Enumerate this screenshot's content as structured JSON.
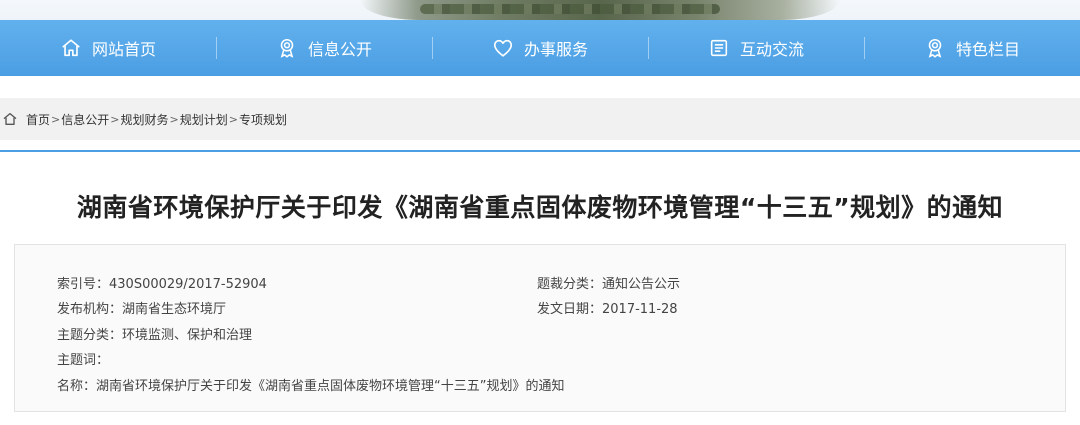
{
  "nav": {
    "items": [
      {
        "label": "网站首页",
        "icon": "home-icon"
      },
      {
        "label": "信息公开",
        "icon": "badge-icon"
      },
      {
        "label": "办事服务",
        "icon": "heart-icon"
      },
      {
        "label": "互动交流",
        "icon": "list-icon"
      },
      {
        "label": "特色栏目",
        "icon": "badge-icon"
      }
    ]
  },
  "breadcrumb": {
    "items": [
      "首页",
      "信息公开",
      "规划财务",
      "规划计划",
      "专项规划"
    ],
    "separator": ">"
  },
  "page_title": "湖南省环境保护厅关于印发《湖南省重点固体废物环境管理“十三五”规划》的通知",
  "meta": {
    "index_no": {
      "label": "索引号：",
      "value": "430S00029/2017-52904"
    },
    "genre": {
      "label": "题裁分类：",
      "value": "通知公告公示"
    },
    "publisher": {
      "label": "发布机构：",
      "value": "湖南省生态环境厅"
    },
    "date": {
      "label": "发文日期：",
      "value": "2017-11-28"
    },
    "topic": {
      "label": "主题分类：",
      "value": "环境监测、保护和治理"
    },
    "keywords": {
      "label": "主题词：",
      "value": ""
    },
    "name": {
      "label": "名称：",
      "value": "湖南省环境保护厅关于印发《湖南省重点固体废物环境管理“十三五”规划》的通知"
    }
  },
  "colors": {
    "nav_bg": "#4b9ee3",
    "accent_line": "#4b9ee3",
    "breadcrumb_bg": "#f1f1f1"
  }
}
